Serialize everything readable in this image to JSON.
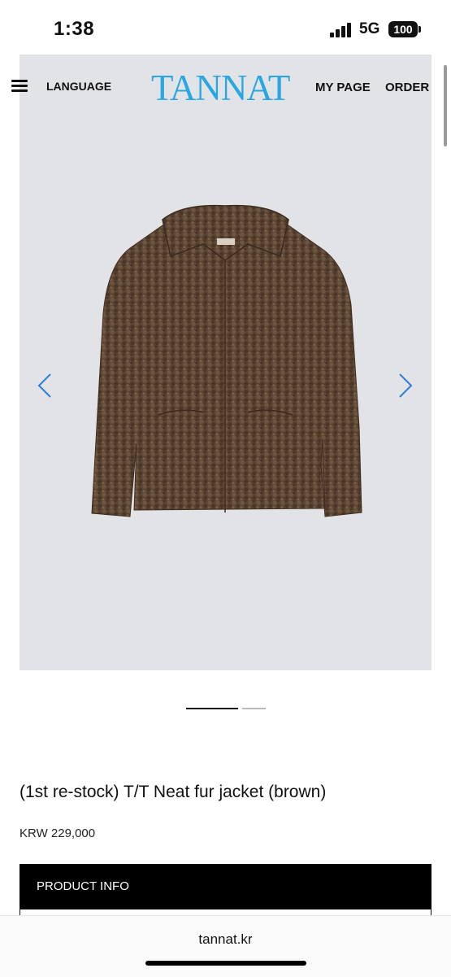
{
  "status": {
    "time": "1:38",
    "network": "5G",
    "battery": "100"
  },
  "header": {
    "language": "LANGUAGE",
    "logo": "TANNAT",
    "my_page": "MY PAGE",
    "order": "ORDER"
  },
  "product": {
    "title": "(1st re-stock) T/T Neat fur jacket (brown)",
    "price": "KRW 229,000",
    "info_tab": "PRODUCT INFO"
  },
  "carousel": {
    "active_slide": 1,
    "total_slides": 2
  },
  "browser": {
    "url": "tannat.kr"
  },
  "colors": {
    "logo": "#2aa7e0",
    "arrow": "#2f7ed8",
    "hero_bg": "#e2e3e6",
    "jacket": "#5a4432"
  }
}
